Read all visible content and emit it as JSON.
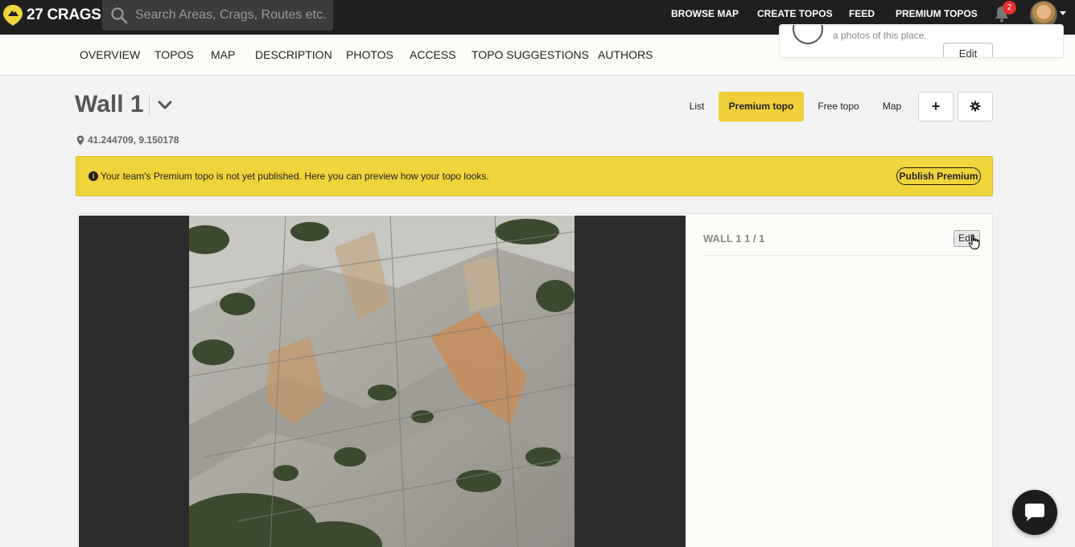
{
  "header": {
    "logo_text": "27 CRAGS",
    "search_placeholder": "Search Areas, Crags, Routes etc.",
    "nav": [
      "BROWSE MAP",
      "CREATE TOPOS",
      "FEED",
      "PREMIUM TOPOS"
    ],
    "notification_count": "2"
  },
  "notification_popover": {
    "text": "a photos of this place.",
    "button_label": "Edit"
  },
  "subnav": [
    "OVERVIEW",
    "TOPOS",
    "MAP",
    "DESCRIPTION",
    "PHOTOS",
    "ACCESS",
    "TOPO SUGGESTIONS",
    "AUTHORS"
  ],
  "page": {
    "title": "Wall 1",
    "coordinates": "41.244709, 9.150178",
    "view_options": {
      "list": "List",
      "premium": "Premium topo",
      "free": "Free topo",
      "map": "Map"
    },
    "add_label": "+",
    "settings_icon": "gear-icon"
  },
  "banner": {
    "text": "Your team's Premium topo is not yet published. Here you can preview how your topo looks.",
    "button_label": "Publish Premium"
  },
  "topo": {
    "sidebar_title": "WALL 1 1 / 1",
    "edit_label": "Edit"
  },
  "colors": {
    "accent_yellow": "#efd43c",
    "topbar_bg": "#1f1f1f",
    "badge_red": "#e0302d"
  }
}
